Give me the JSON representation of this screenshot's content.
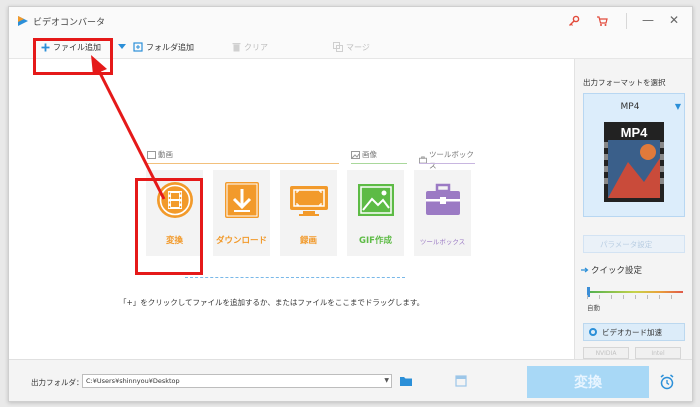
{
  "app": {
    "title": "ビデオコンバータ",
    "icons": {
      "logo": "app-logo",
      "key": "key-icon",
      "cart": "cart-icon"
    },
    "window_buttons": {
      "minimize": "—",
      "maximize": "□",
      "close": "✕"
    }
  },
  "toolbar": {
    "add_file_label": "ファイル追加",
    "add_folder_label": "フォルダ追加",
    "clear_label": "クリア",
    "merge_label": "マージ"
  },
  "categories": {
    "video": "動画",
    "image": "画像",
    "toolbox": "ツールボックス"
  },
  "tiles": [
    {
      "label": "変換",
      "icon": "film-icon",
      "color": "#f29a2b"
    },
    {
      "label": "ダウンロード",
      "icon": "download-icon",
      "color": "#f29a2b"
    },
    {
      "label": "録画",
      "icon": "screen-record-icon",
      "color": "#f29a2b"
    },
    {
      "label": "GIF作成",
      "icon": "gif-image-icon",
      "color": "#5dbb45"
    },
    {
      "label": "ツールボックス",
      "icon": "toolbox-icon",
      "color": "#9b7ac4"
    }
  ],
  "hint": "「+」をクリックしてファイルを追加するか、またはファイルをここまでドラッグします。",
  "right_panel": {
    "title": "出力フォーマットを選択",
    "format": "MP4",
    "format_image_text": "MP4",
    "param_button": "パラメータ設定",
    "quick_settings": "クイック設定",
    "quality_level": "自動",
    "gpu_button": "ビデオカード加速",
    "vendors": [
      "NVIDIA",
      "Intel"
    ]
  },
  "bottom": {
    "output_folder_label": "出力フォルダ：",
    "output_path": "C:¥Users¥shinnyou¥Desktop",
    "convert_button": "変換"
  },
  "colors": {
    "accent": "#2b8fd8",
    "annotation": "#e51919",
    "convert_tile": "#f29a2b",
    "gif_tile": "#5dbb45",
    "toolbox_tile": "#9b7ac4"
  }
}
